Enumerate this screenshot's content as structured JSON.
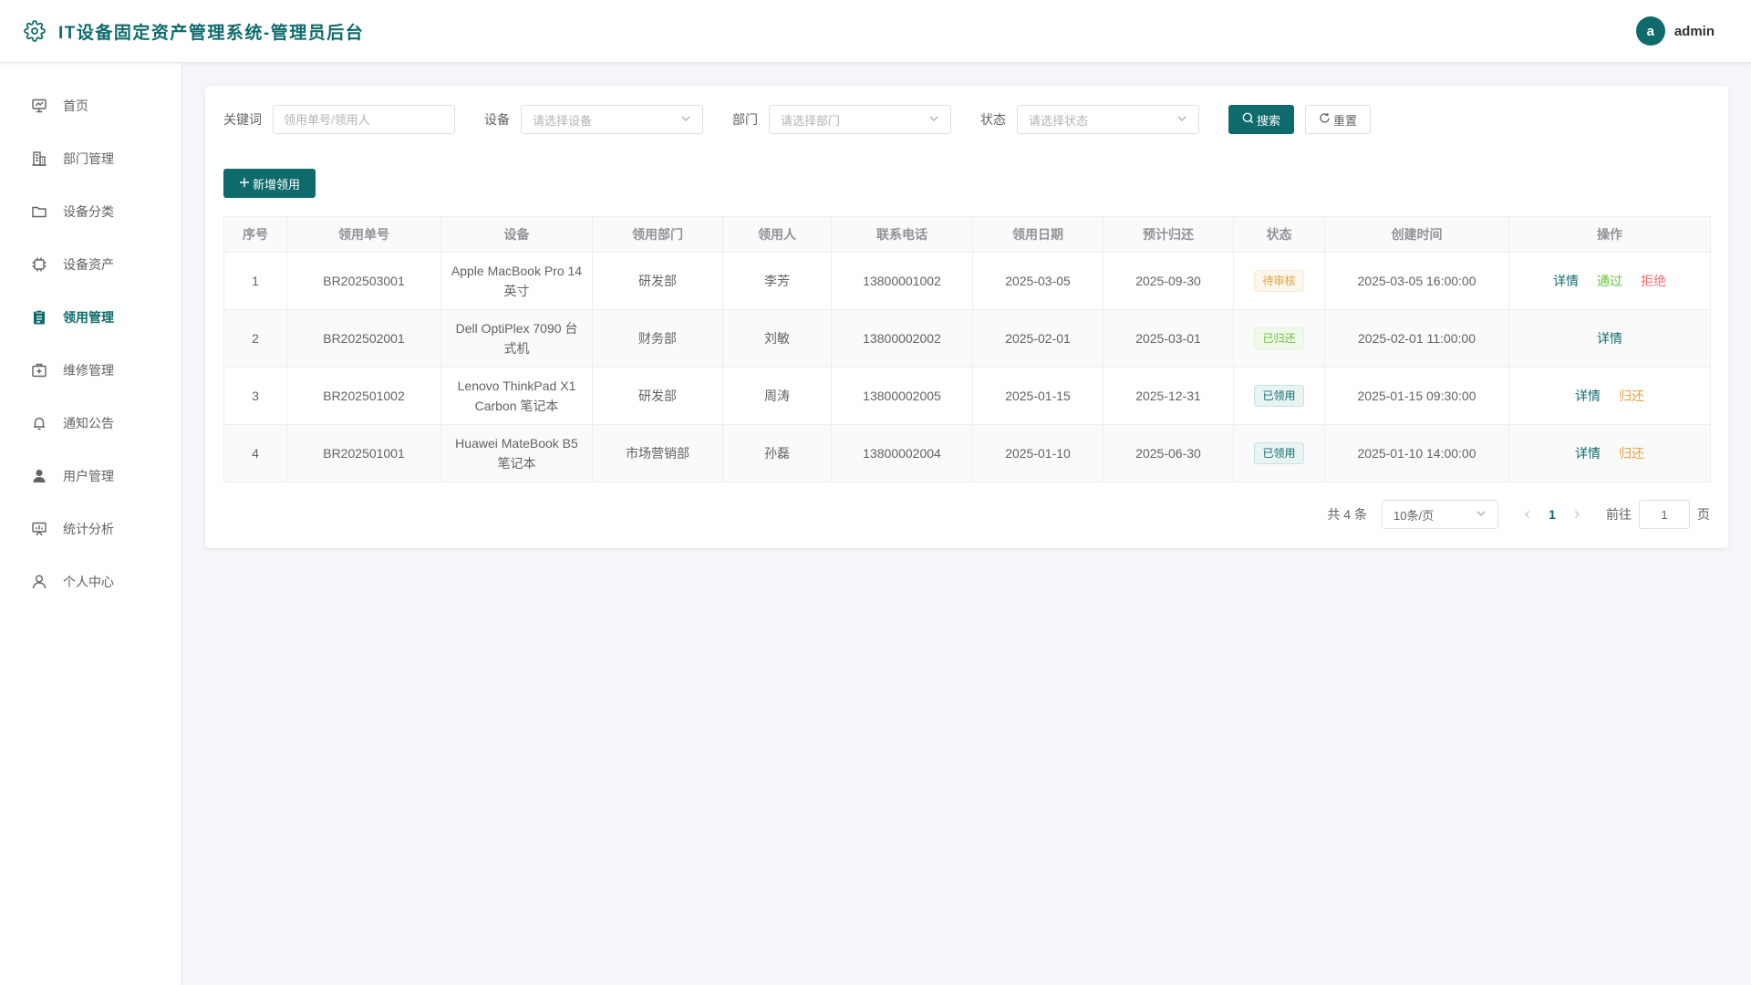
{
  "header": {
    "title": "IT设备固定资产管理系统-管理员后台",
    "avatar_letter": "a",
    "username": "admin"
  },
  "sidebar": {
    "items": [
      {
        "label": "首页",
        "icon": "dashboard-icon",
        "active": false
      },
      {
        "label": "部门管理",
        "icon": "building-icon",
        "active": false
      },
      {
        "label": "设备分类",
        "icon": "folder-icon",
        "active": false
      },
      {
        "label": "设备资产",
        "icon": "chip-icon",
        "active": false
      },
      {
        "label": "领用管理",
        "icon": "clipboard-icon",
        "active": true
      },
      {
        "label": "维修管理",
        "icon": "medical-box-icon",
        "active": false
      },
      {
        "label": "通知公告",
        "icon": "bell-icon",
        "active": false
      },
      {
        "label": "用户管理",
        "icon": "user-filled-icon",
        "active": false
      },
      {
        "label": "统计分析",
        "icon": "chart-board-icon",
        "active": false
      },
      {
        "label": "个人中心",
        "icon": "user-outline-icon",
        "active": false
      }
    ]
  },
  "filters": {
    "keyword_label": "关键词",
    "keyword_placeholder": "领用单号/领用人",
    "device_label": "设备",
    "device_placeholder": "请选择设备",
    "department_label": "部门",
    "department_placeholder": "请选择部门",
    "status_label": "状态",
    "status_placeholder": "请选择状态",
    "search_label": "搜索",
    "reset_label": "重置"
  },
  "toolbar": {
    "add_label": "新增领用"
  },
  "table": {
    "columns": [
      "序号",
      "领用单号",
      "设备",
      "领用部门",
      "领用人",
      "联系电话",
      "领用日期",
      "预计归还",
      "状态",
      "创建时间",
      "操作"
    ],
    "rows": [
      {
        "index": "1",
        "order_no": "BR202503001",
        "device": "Apple MacBook Pro 14英寸",
        "department": "研发部",
        "user": "李芳",
        "phone": "13800001002",
        "date": "2025-03-05",
        "return_date": "2025-09-30",
        "status": "待审核",
        "created": "2025-03-05 16:00:00",
        "actions": [
          "详情",
          "通过",
          "拒绝"
        ]
      },
      {
        "index": "2",
        "order_no": "BR202502001",
        "device": "Dell OptiPlex 7090 台式机",
        "department": "财务部",
        "user": "刘敏",
        "phone": "13800002002",
        "date": "2025-02-01",
        "return_date": "2025-03-01",
        "status": "已归还",
        "created": "2025-02-01 11:00:00",
        "actions": [
          "详情"
        ]
      },
      {
        "index": "3",
        "order_no": "BR202501002",
        "device": "Lenovo ThinkPad X1 Carbon 笔记本",
        "department": "研发部",
        "user": "周涛",
        "phone": "13800002005",
        "date": "2025-01-15",
        "return_date": "2025-12-31",
        "status": "已领用",
        "created": "2025-01-15 09:30:00",
        "actions": [
          "详情",
          "归还"
        ]
      },
      {
        "index": "4",
        "order_no": "BR202501001",
        "device": "Huawei MateBook B5 笔记本",
        "department": "市场营销部",
        "user": "孙磊",
        "phone": "13800002004",
        "date": "2025-01-10",
        "return_date": "2025-06-30",
        "status": "已领用",
        "created": "2025-01-10 14:00:00",
        "actions": [
          "详情",
          "归还"
        ]
      }
    ]
  },
  "pagination": {
    "total_text": "共 4 条",
    "page_size": "10条/页",
    "current_page": "1",
    "goto_label": "前往",
    "goto_value": "1",
    "page_suffix": "页"
  },
  "colors": {
    "primary": "#0f6b6b",
    "pending": "#e6a23c",
    "returned": "#67c23a",
    "reject": "#f56c6c"
  }
}
